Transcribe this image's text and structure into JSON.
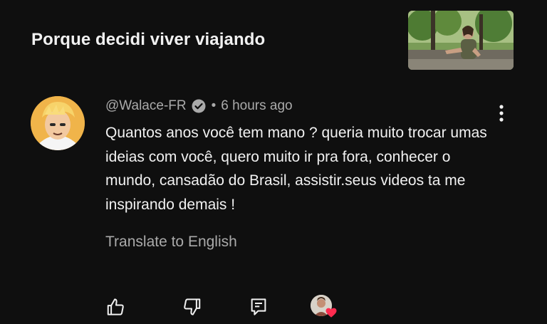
{
  "video": {
    "title": "Porque decidi viver viajando",
    "thumbnail_icon": "video-thumbnail"
  },
  "comment": {
    "author": "@Walace-FR",
    "verified_icon": "verified-check-icon",
    "separator": "•",
    "time": "6 hours ago",
    "text": "Quantos anos você tem mano ? queria muito trocar umas ideias com você, quero muito ir pra fora, conhecer o mundo, cansadão do Brasil, assistir.seus videos ta me inspirando demais !",
    "translate_label": "Translate to English"
  },
  "actions": {
    "like_icon": "thumbs-up-icon",
    "dislike_icon": "thumbs-down-icon",
    "reply_icon": "reply-comment-icon",
    "creator_heart_icon": "creator-heart-icon"
  },
  "colors": {
    "background": "#0f0f0f",
    "text_primary": "#f1f1f1",
    "text_secondary": "#aaaaaa",
    "heart": "#ff2b4f"
  }
}
